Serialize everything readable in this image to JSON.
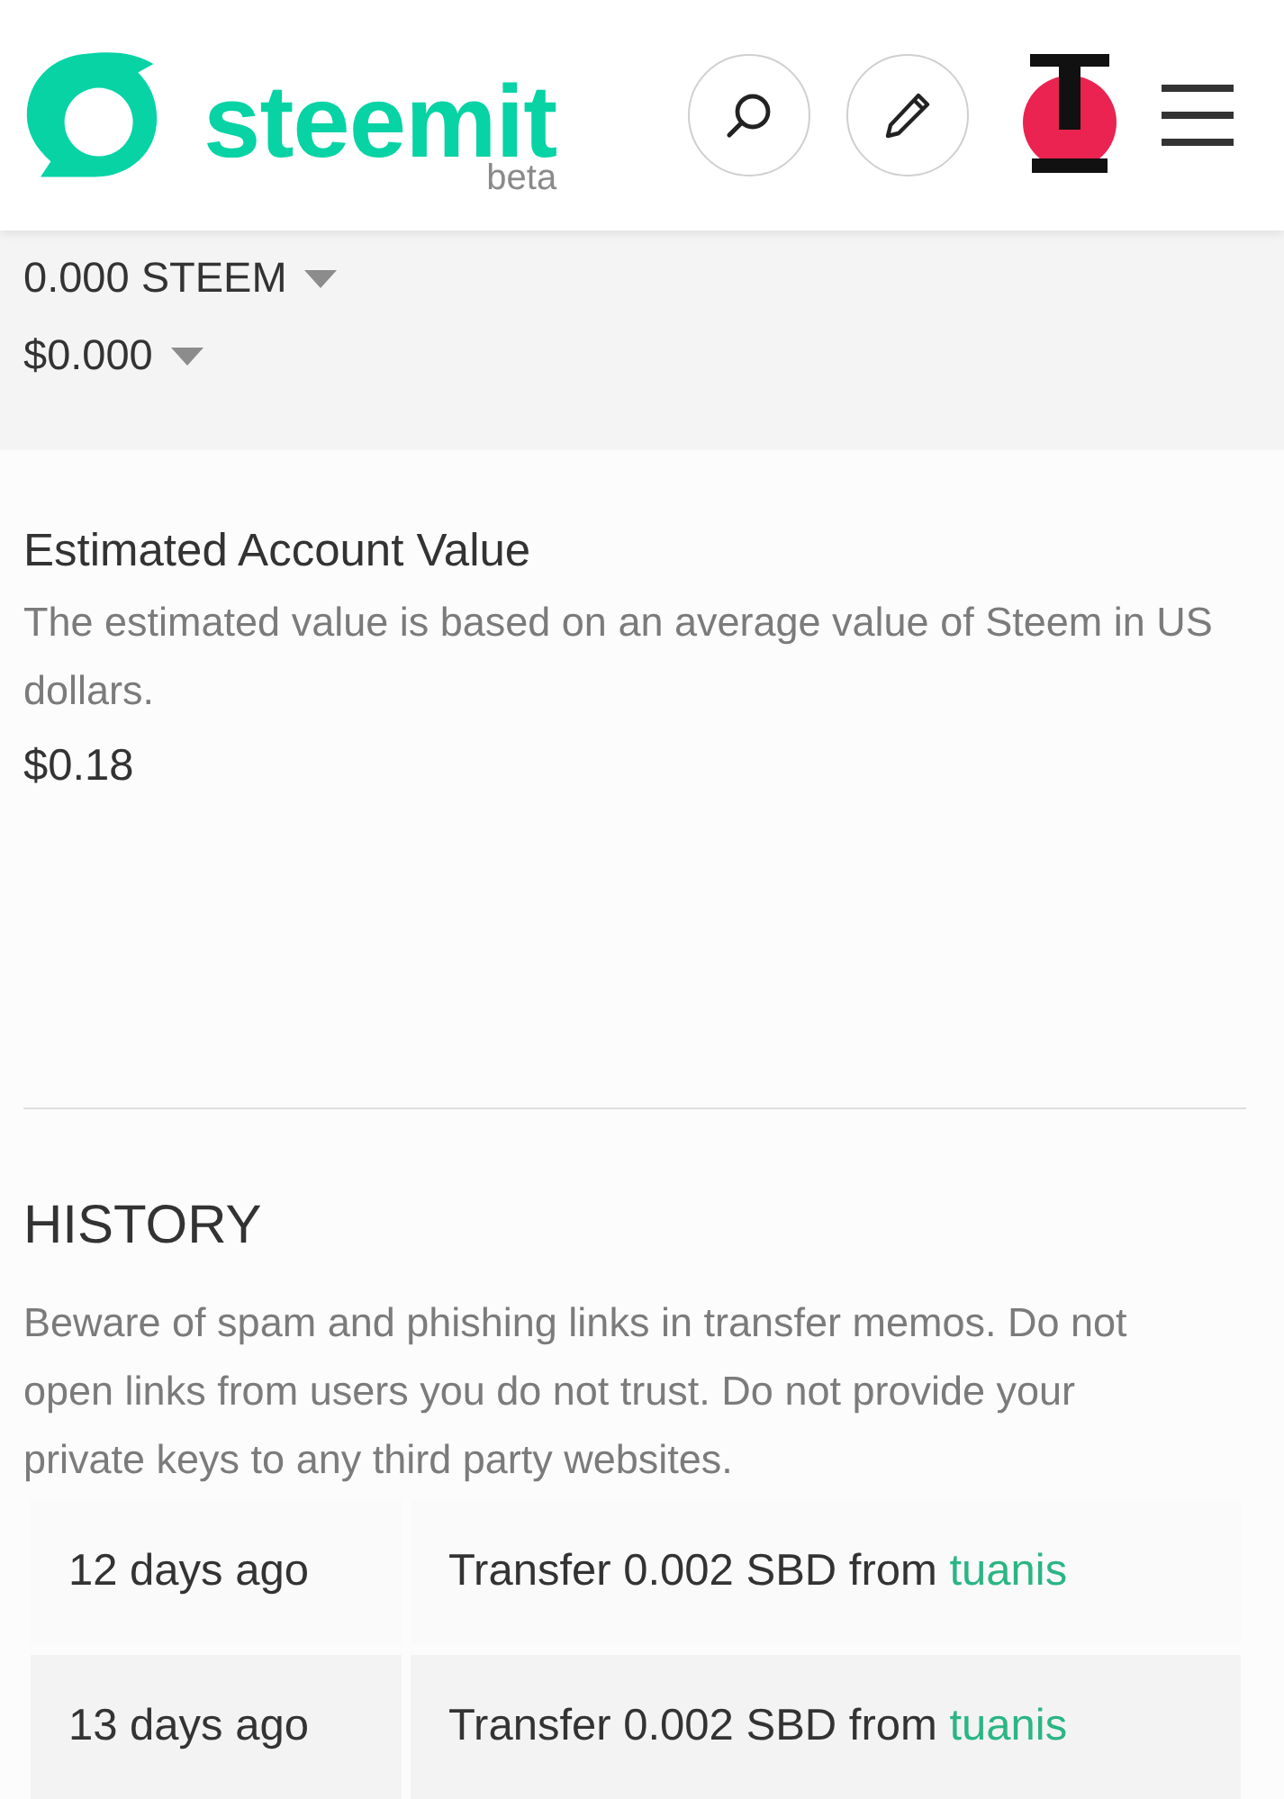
{
  "header": {
    "logo_text": "steemit",
    "logo_badge": "beta"
  },
  "balances": [
    {
      "amount": "0.000 STEEM"
    },
    {
      "amount": "$0.000"
    }
  ],
  "estimated_value": {
    "title": "Estimated Account Value",
    "description": "The estimated value is based on an average value of Steem in US dollars.",
    "value": "$0.18"
  },
  "history": {
    "title": "HISTORY",
    "warning": "Beware of spam and phishing links in transfer memos. Do not open links from users you do not trust. Do not provide your private keys to any third party websites.",
    "rows": [
      {
        "time": "12 days ago",
        "description": "Transfer 0.002 SBD from",
        "user": "tuanis"
      },
      {
        "time": "13 days ago",
        "description": "Transfer 0.002 SBD from",
        "user": "tuanis"
      }
    ]
  }
}
